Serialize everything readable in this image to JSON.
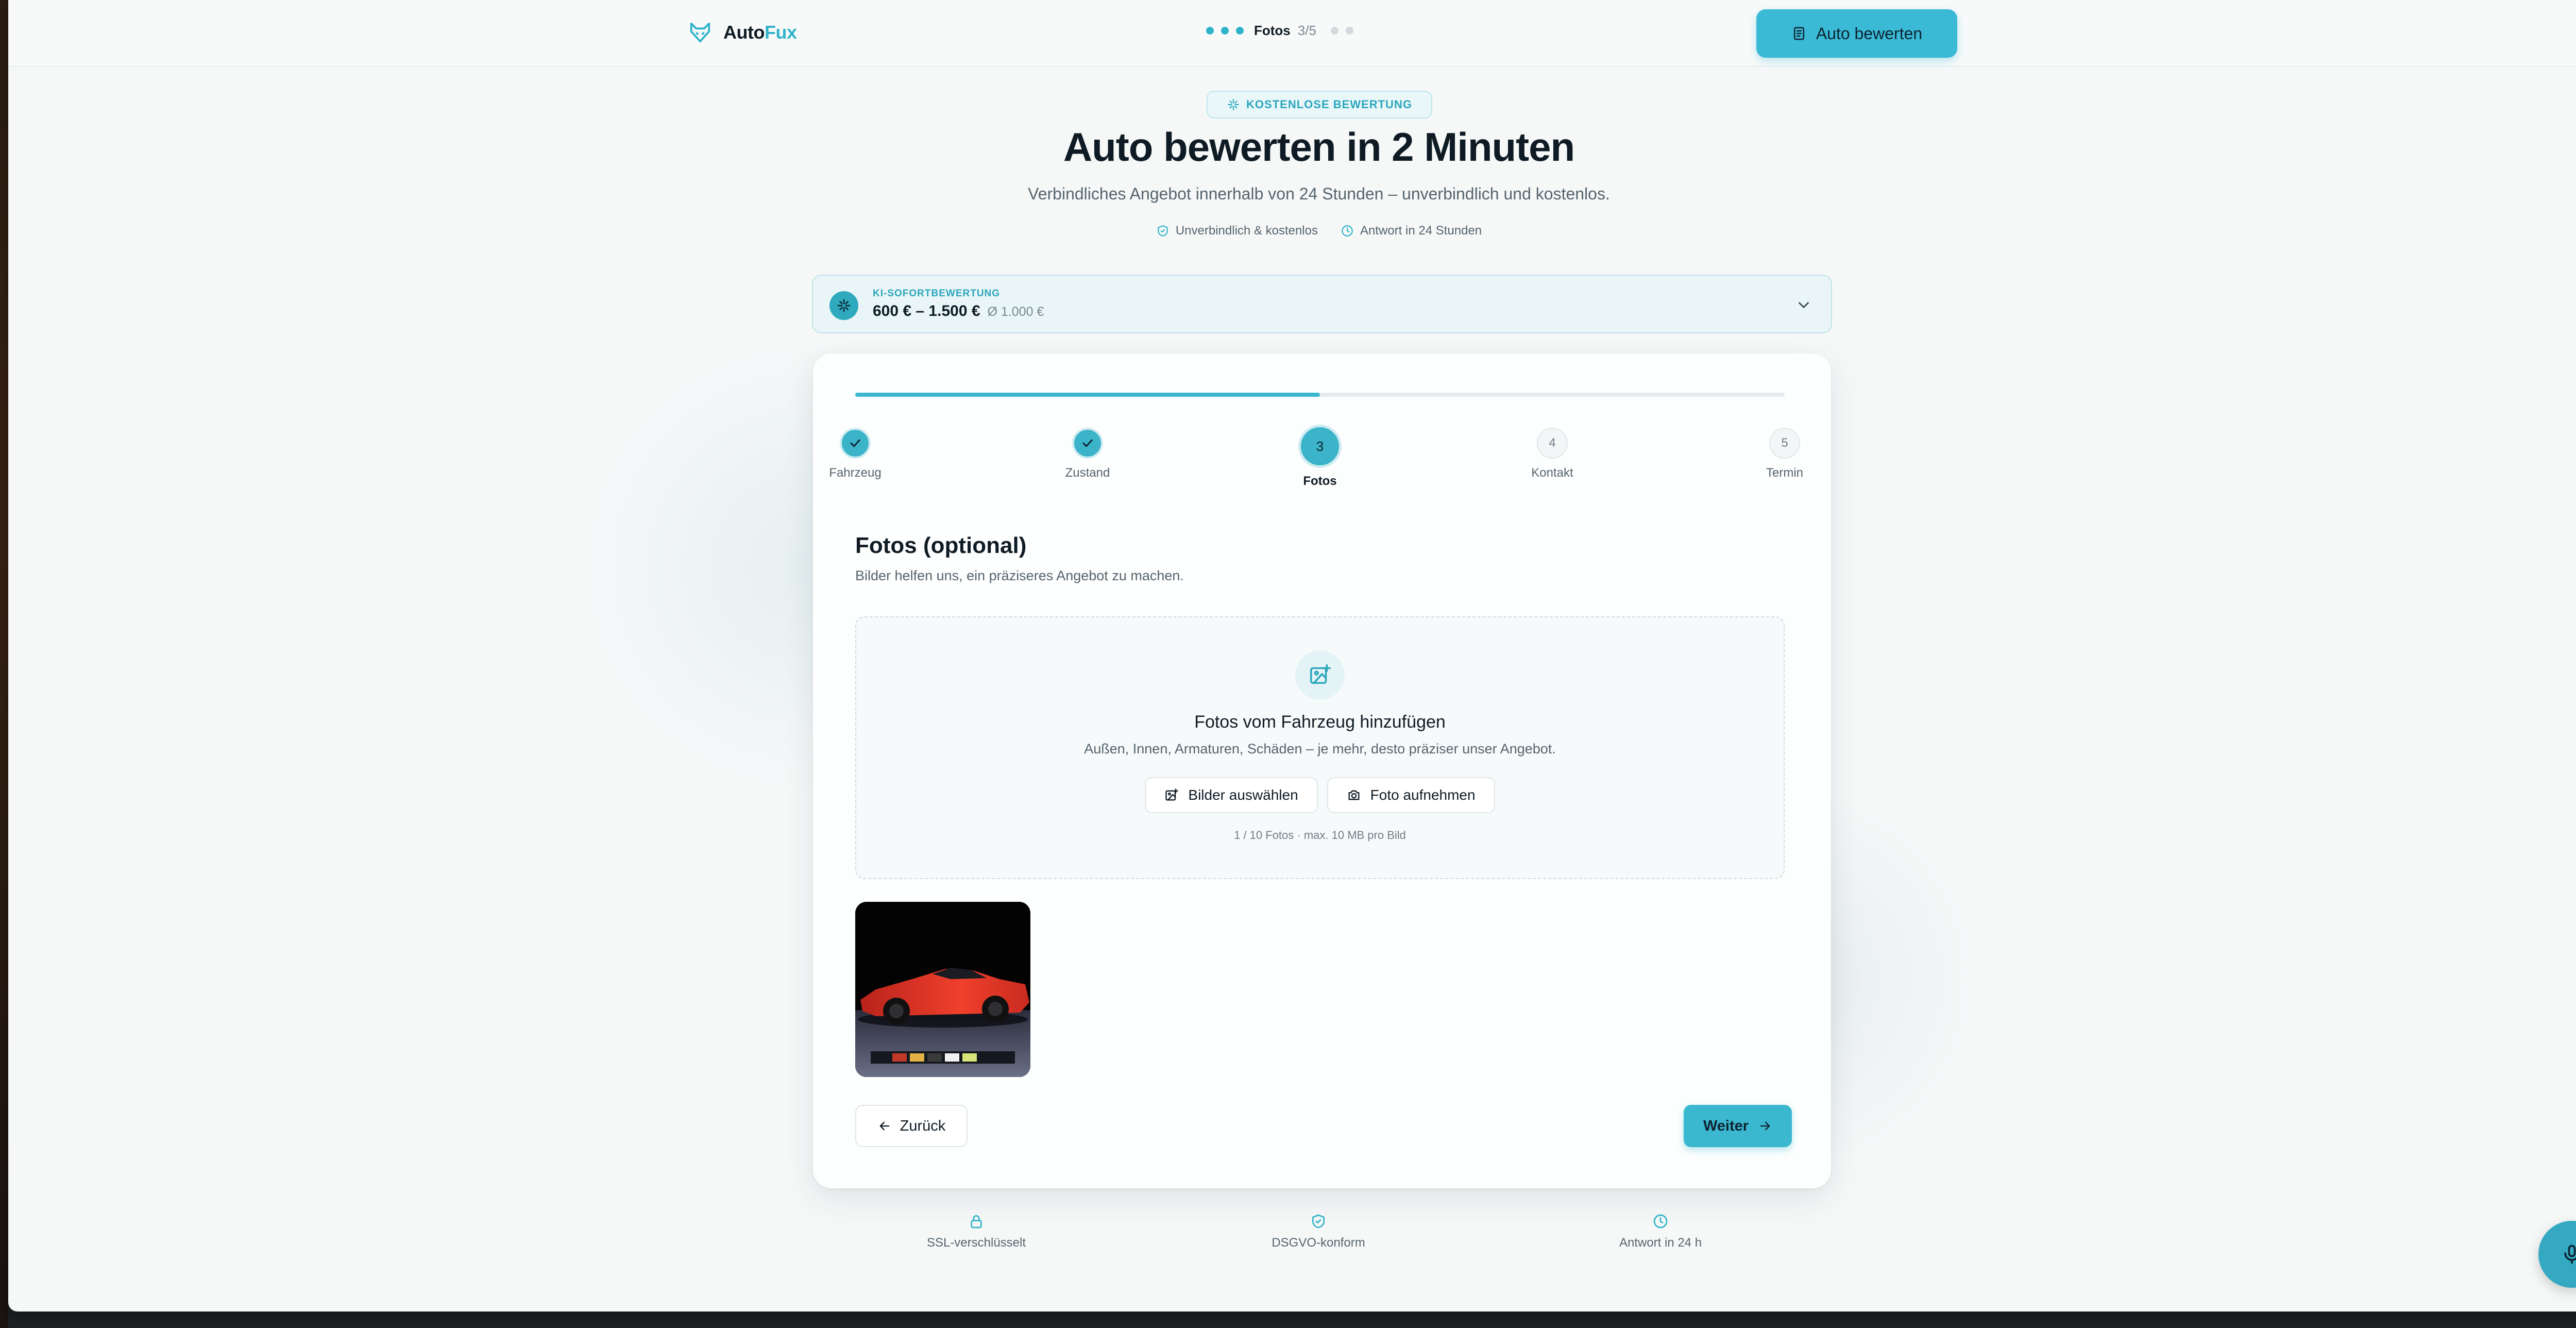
{
  "header": {
    "brand_main": "Auto",
    "brand_accent": "Fux",
    "progress_label": "Fotos",
    "progress_count": "3/5",
    "cta_label": "Auto bewerten"
  },
  "hero": {
    "badge": "KOSTENLOSE BEWERTUNG",
    "title": "Auto bewerten in 2 Minuten",
    "subtitle": "Verbindliches Angebot innerhalb von 24 Stunden – unverbindlich und kostenlos.",
    "trust_1": "Unverbindlich & kostenlos",
    "trust_2": "Antwort in 24 Stunden"
  },
  "ki": {
    "label": "KI-SOFORTBEWERTUNG",
    "range": "600 € – 1.500 €",
    "average": "Ø 1.000 €"
  },
  "wizard": {
    "progress_fraction": 0.5,
    "steps": [
      {
        "number": "1",
        "label": "Fahrzeug",
        "state": "done"
      },
      {
        "number": "2",
        "label": "Zustand",
        "state": "done"
      },
      {
        "number": "3",
        "label": "Fotos",
        "state": "active"
      },
      {
        "number": "4",
        "label": "Kontakt",
        "state": "todo"
      },
      {
        "number": "5",
        "label": "Termin",
        "state": "todo"
      }
    ],
    "section_title": "Fotos (optional)",
    "section_subtitle": "Bilder helfen uns, ein präziseres Angebot zu machen."
  },
  "upload": {
    "title": "Fotos vom Fahrzeug hinzufügen",
    "subtitle": "Außen, Innen, Armaturen, Schäden – je mehr, desto präziser unser Angebot.",
    "select_label": "Bilder auswählen",
    "camera_label": "Foto aufnehmen",
    "meta": "1 / 10 Fotos · max. 10 MB pro Bild"
  },
  "nav": {
    "back_label": "Zurück",
    "next_label": "Weiter"
  },
  "footer": {
    "ssl": "SSL-verschlüsselt",
    "dsgvo": "DSGVO-konform",
    "response": "Antwort in 24 h"
  },
  "colors": {
    "accent": "#3bb7cf",
    "accent_dark": "#2aa6bc",
    "text": "#0f1b24",
    "muted": "#55646d"
  },
  "icons": {
    "logo": "fox-icon",
    "cta": "clipboard-icon",
    "badge": "sparkles-icon",
    "trust_1": "shield-check-icon",
    "trust_2": "clock-icon",
    "ki": "sparkles-icon",
    "dropzone": "image-plus-icon",
    "select": "image-plus-icon",
    "camera": "camera-icon",
    "back": "arrow-left-icon",
    "next": "arrow-right-icon",
    "mic": "microphone-icon"
  }
}
